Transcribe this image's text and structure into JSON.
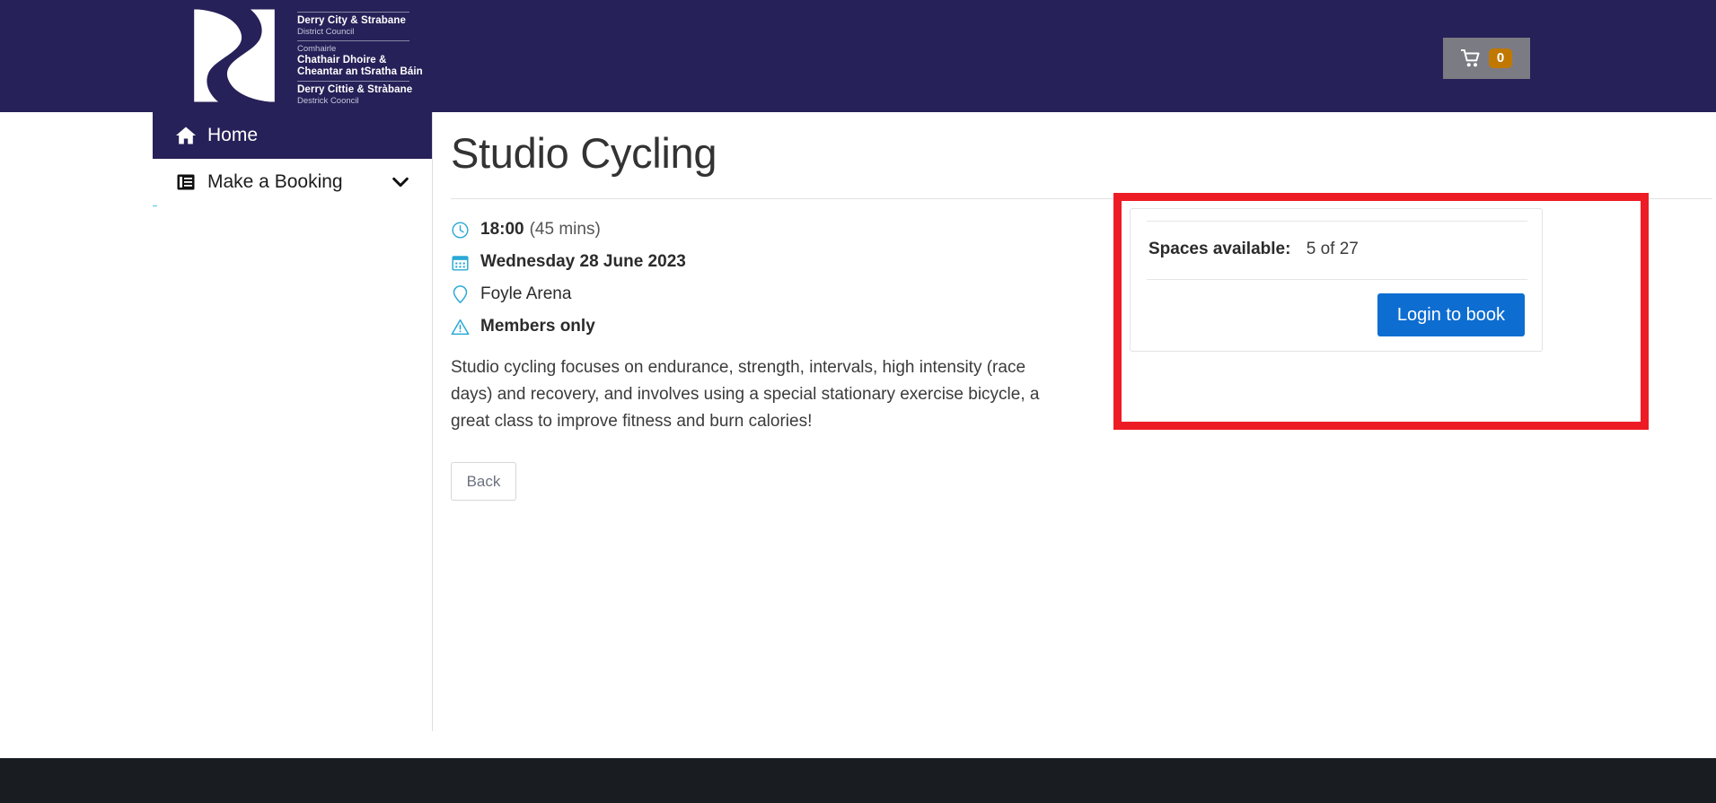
{
  "header": {
    "background_color": "#262158",
    "logo": {
      "icon": "derry-strabane-river-s-logo",
      "lines": [
        {
          "text": "Derry City & Strabane",
          "style": "strong"
        },
        {
          "text": "District Council",
          "style": "light"
        },
        {
          "text": "Comhairle",
          "style": "light"
        },
        {
          "text": "Chathair Dhoire &",
          "style": "strong"
        },
        {
          "text": "Cheantar an tSratha Báin",
          "style": "strong"
        },
        {
          "text": "Derry Cittie & Stràbane",
          "style": "strong"
        },
        {
          "text": "Destrick Cooncil",
          "style": "light"
        }
      ]
    },
    "cart": {
      "icon": "shopping-cart-icon",
      "count": "0",
      "badge_color": "#c07800",
      "button_color": "#7b7b84"
    }
  },
  "sidebar": {
    "accent_color": "#4fc3e8",
    "items": [
      {
        "label": "Home",
        "icon": "home-icon",
        "active": true
      },
      {
        "label": "Make a Booking",
        "icon": "book-icon",
        "active": false,
        "chevron": "chevron-down-icon"
      }
    ]
  },
  "main": {
    "title": "Studio Cycling",
    "meta": [
      {
        "icon": "clock-icon",
        "value": "18:00",
        "suffix": "(45 mins)",
        "bold": true
      },
      {
        "icon": "calendar-icon",
        "value": "Wednesday 28 June 2023",
        "suffix": "",
        "bold": true
      },
      {
        "icon": "map-pin-icon",
        "value": "Foyle Arena",
        "suffix": "",
        "bold": false
      },
      {
        "icon": "warning-triangle-icon",
        "value": "Members only",
        "suffix": "",
        "bold": true
      }
    ],
    "description": "Studio cycling focuses on endurance, strength, intervals, high intensity (race days) and recovery, and involves using a special stationary exercise bicycle, a great class to improve fitness and burn calories!",
    "back_button": "Back"
  },
  "booking_panel": {
    "highlight_color": "#ed1c24",
    "spaces_label": "Spaces available:",
    "spaces_value": "5 of 27",
    "login_button": "Login to book",
    "login_button_color": "#0d6dd1"
  },
  "footer": {
    "background_color": "#191c21"
  }
}
